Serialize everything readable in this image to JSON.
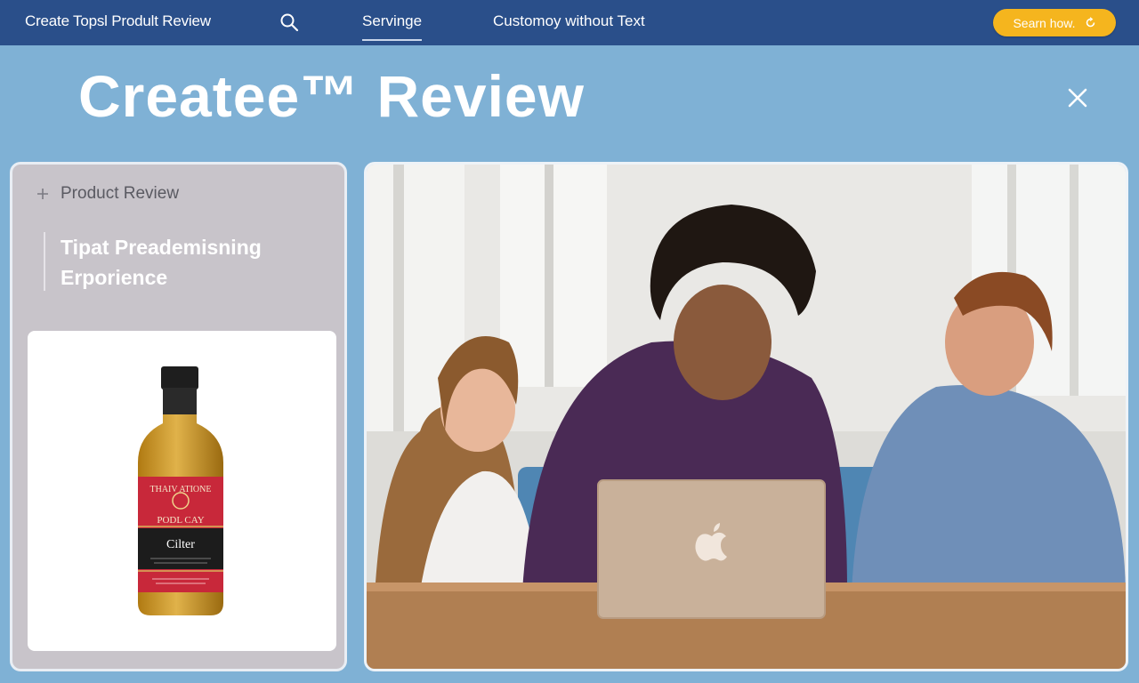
{
  "topbar": {
    "title": "Create Topsl Prodult Review",
    "search_icon": "search-icon",
    "nav": [
      {
        "label": "Servinge",
        "active": true
      },
      {
        "label": "Customoy without Text",
        "active": false
      }
    ],
    "cta": {
      "label": "Searn how.",
      "icon": "refresh-icon",
      "color": "#f5b51e"
    }
  },
  "hero": {
    "title": "Createe™ Review",
    "close_icon": "close-icon"
  },
  "sidebar": {
    "section_label": "Product Review",
    "section_icon": "plus-icon",
    "blurb_line1": "Tipat Preademisning",
    "blurb_line2": "Erporience",
    "product_label": {
      "line1": "THAIV ATIONE",
      "line2": "PODL CAY",
      "line3": "Cilter"
    }
  },
  "photo": {
    "scene": "three-people-laptop",
    "laptop_icon": "apple-logo-icon"
  },
  "colors": {
    "topbar": "#2a4f8a",
    "background": "#7fb1d5",
    "accent": "#f5b51e"
  }
}
